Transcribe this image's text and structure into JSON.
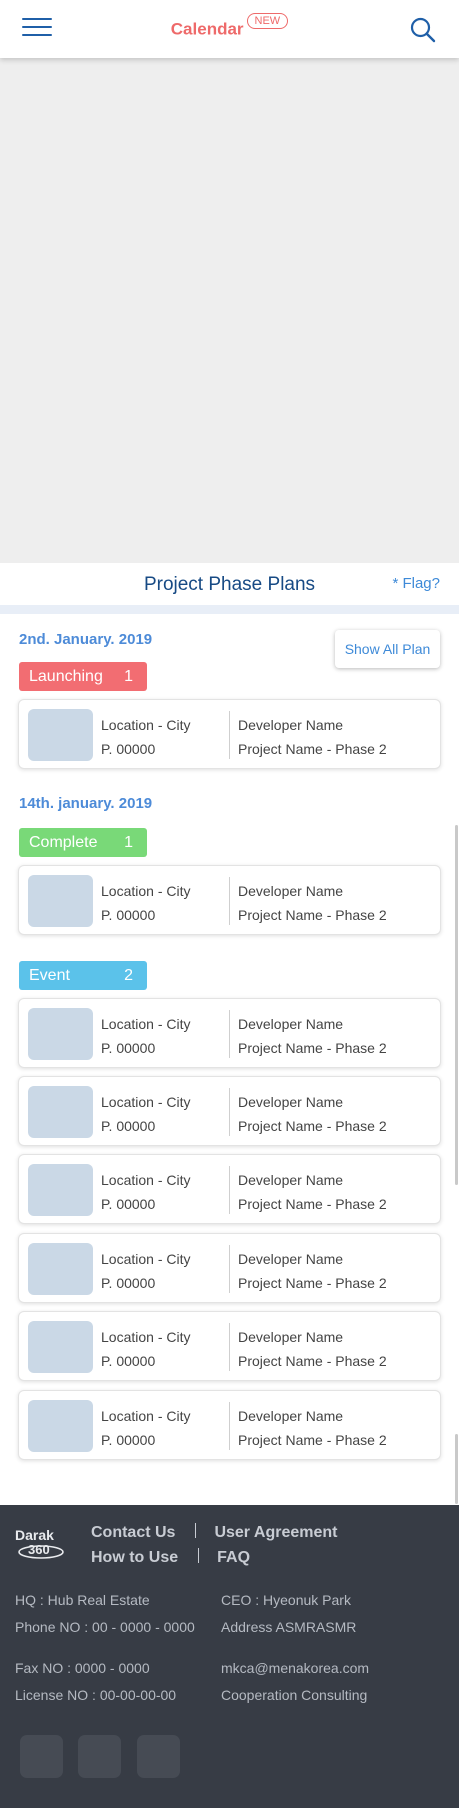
{
  "header": {
    "title": "Calendar",
    "badge": "NEW",
    "menu_icon": "hamburger-menu-icon",
    "search_icon": "search-icon"
  },
  "section": {
    "title": "Project Phase Plans",
    "flag_link": "* Flag?",
    "show_all_button": "Show All Plan"
  },
  "groups": [
    {
      "date": "2nd. January. 2019",
      "categories": [
        {
          "label": "Launching",
          "count": "1",
          "color": "#f26d72",
          "projects": [
            {
              "location": "Location - City",
              "price": "P. 00000",
              "developer": "Developer Name",
              "project": "Project Name - Phase 2"
            }
          ]
        }
      ]
    },
    {
      "date": "14th. january. 2019",
      "categories": [
        {
          "label": "Complete",
          "count": "1",
          "color": "#79d978",
          "projects": [
            {
              "location": "Location - City",
              "price": "P. 00000",
              "developer": "Developer Name",
              "project": "Project Name - Phase 2"
            }
          ]
        },
        {
          "label": "Event",
          "count": "2",
          "color": "#5bc2ea",
          "projects": [
            {
              "location": "Location - City",
              "price": "P. 00000",
              "developer": "Developer Name",
              "project": "Project Name - Phase 2"
            },
            {
              "location": "Location - City",
              "price": "P. 00000",
              "developer": "Developer Name",
              "project": "Project Name - Phase 2"
            },
            {
              "location": "Location - City",
              "price": "P. 00000",
              "developer": "Developer Name",
              "project": "Project Name - Phase 2"
            },
            {
              "location": "Location - City",
              "price": "P. 00000",
              "developer": "Developer Name",
              "project": "Project Name - Phase 2"
            },
            {
              "location": "Location - City",
              "price": "P. 00000",
              "developer": "Developer Name",
              "project": "Project Name - Phase 2"
            },
            {
              "location": "Location - City",
              "price": "P. 00000",
              "developer": "Developer Name",
              "project": "Project Name - Phase 2"
            }
          ]
        }
      ]
    }
  ],
  "footer": {
    "logo_text": "Darak 360",
    "links": [
      "Contact Us",
      "User Agreement",
      "How to Use",
      "FAQ"
    ],
    "hq": "HQ : Hub Real Estate",
    "phone": "Phone NO : 00 - 0000 - 0000",
    "ceo": "CEO : Hyeonuk Park",
    "address": "Address ASMRASMR",
    "fax": "Fax NO : 0000 - 0000",
    "license": "License NO : 00-00-00-00",
    "email": "mkca@menakorea.com",
    "cooperation": "Cooperation Consulting",
    "social_icons": [
      "social-icon-1",
      "social-icon-2",
      "social-icon-3"
    ]
  }
}
